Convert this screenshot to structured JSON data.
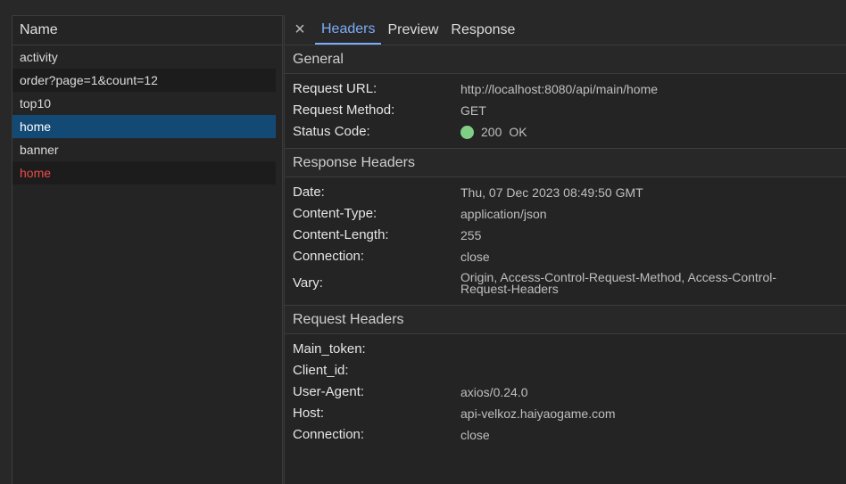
{
  "left": {
    "header": "Name",
    "requests": [
      {
        "name": "activity",
        "state": "normal"
      },
      {
        "name": "order?page=1&count=12",
        "state": "normal"
      },
      {
        "name": "top10",
        "state": "normal"
      },
      {
        "name": "home",
        "state": "selected"
      },
      {
        "name": "banner",
        "state": "normal"
      },
      {
        "name": "home",
        "state": "error"
      }
    ]
  },
  "tabs": {
    "close_icon": "×",
    "headers": "Headers",
    "preview": "Preview",
    "response": "Response",
    "active": "Headers"
  },
  "general": {
    "title": "General",
    "request_url_label": "Request URL:",
    "request_url": "http://localhost:8080/api/main/home",
    "request_method_label": "Request Method:",
    "request_method": "GET",
    "status_code_label": "Status Code:",
    "status_code": "200",
    "status_text": "OK",
    "status_color": "#7fcf87"
  },
  "response_headers": {
    "title": "Response Headers",
    "date_label": "Date:",
    "date": "Thu, 07 Dec 2023 08:49:50 GMT",
    "content_type_label": "Content-Type:",
    "content_type": "application/json",
    "content_length_label": "Content-Length:",
    "content_length": "255",
    "connection_label": "Connection:",
    "connection": "close",
    "vary_label": "Vary:",
    "vary_line1": "Origin, Access-Control-Request-Method, Access-Control-",
    "vary_line2": "Request-Headers"
  },
  "request_headers": {
    "title": "Request Headers",
    "main_token_label": "Main_token:",
    "main_token": "",
    "client_id_label": "Client_id:",
    "client_id": "",
    "user_agent_label": "User-Agent:",
    "user_agent": "axios/0.24.0",
    "host_label": "Host:",
    "host": "api-velkoz.haiyaogame.com",
    "connection_label": "Connection:",
    "connection": "close"
  },
  "colors": {
    "selected_row": "#134a75",
    "error_text": "#ef4b45",
    "active_tab": "#7cacf8"
  }
}
